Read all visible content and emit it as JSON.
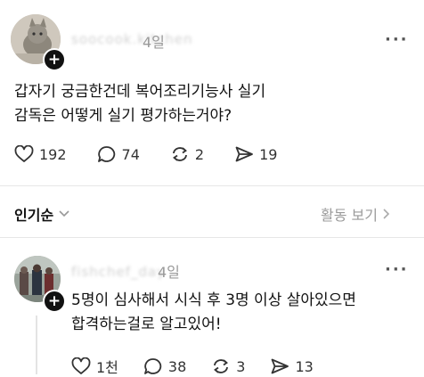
{
  "post": {
    "username": "soocook.kitchen",
    "time": "4일",
    "more": "···",
    "text_line1": "갑자기 궁금한건데 복어조리기능사 실기",
    "text_line2": "감독은 어떻게 실기 평가하는거야?",
    "likes": "192",
    "comments": "74",
    "reposts": "2",
    "shares": "19"
  },
  "sort_bar": {
    "sort_label": "인기순",
    "view_activity_label": "활동 보기"
  },
  "reply": {
    "username": "fishchef_day",
    "time": "4일",
    "more": "···",
    "text_line1": "5명이 심사해서 시식 후 3명 이상 살아있으면",
    "text_line2": "합격하는걸로 알고있어!",
    "likes": "1천",
    "comments": "38",
    "reposts": "3",
    "shares": "13"
  },
  "icons": {
    "like": "heart-icon",
    "comment": "comment-bubble-icon",
    "repost": "repost-icon",
    "share": "send-icon",
    "chevron_down": "chevron-down-icon",
    "chevron_right": "chevron-right-icon",
    "follow": "plus-icon"
  },
  "colors": {
    "text": "#111111",
    "muted": "#9a9a9a",
    "divider": "#e6e6e6",
    "badge": "#111111"
  }
}
